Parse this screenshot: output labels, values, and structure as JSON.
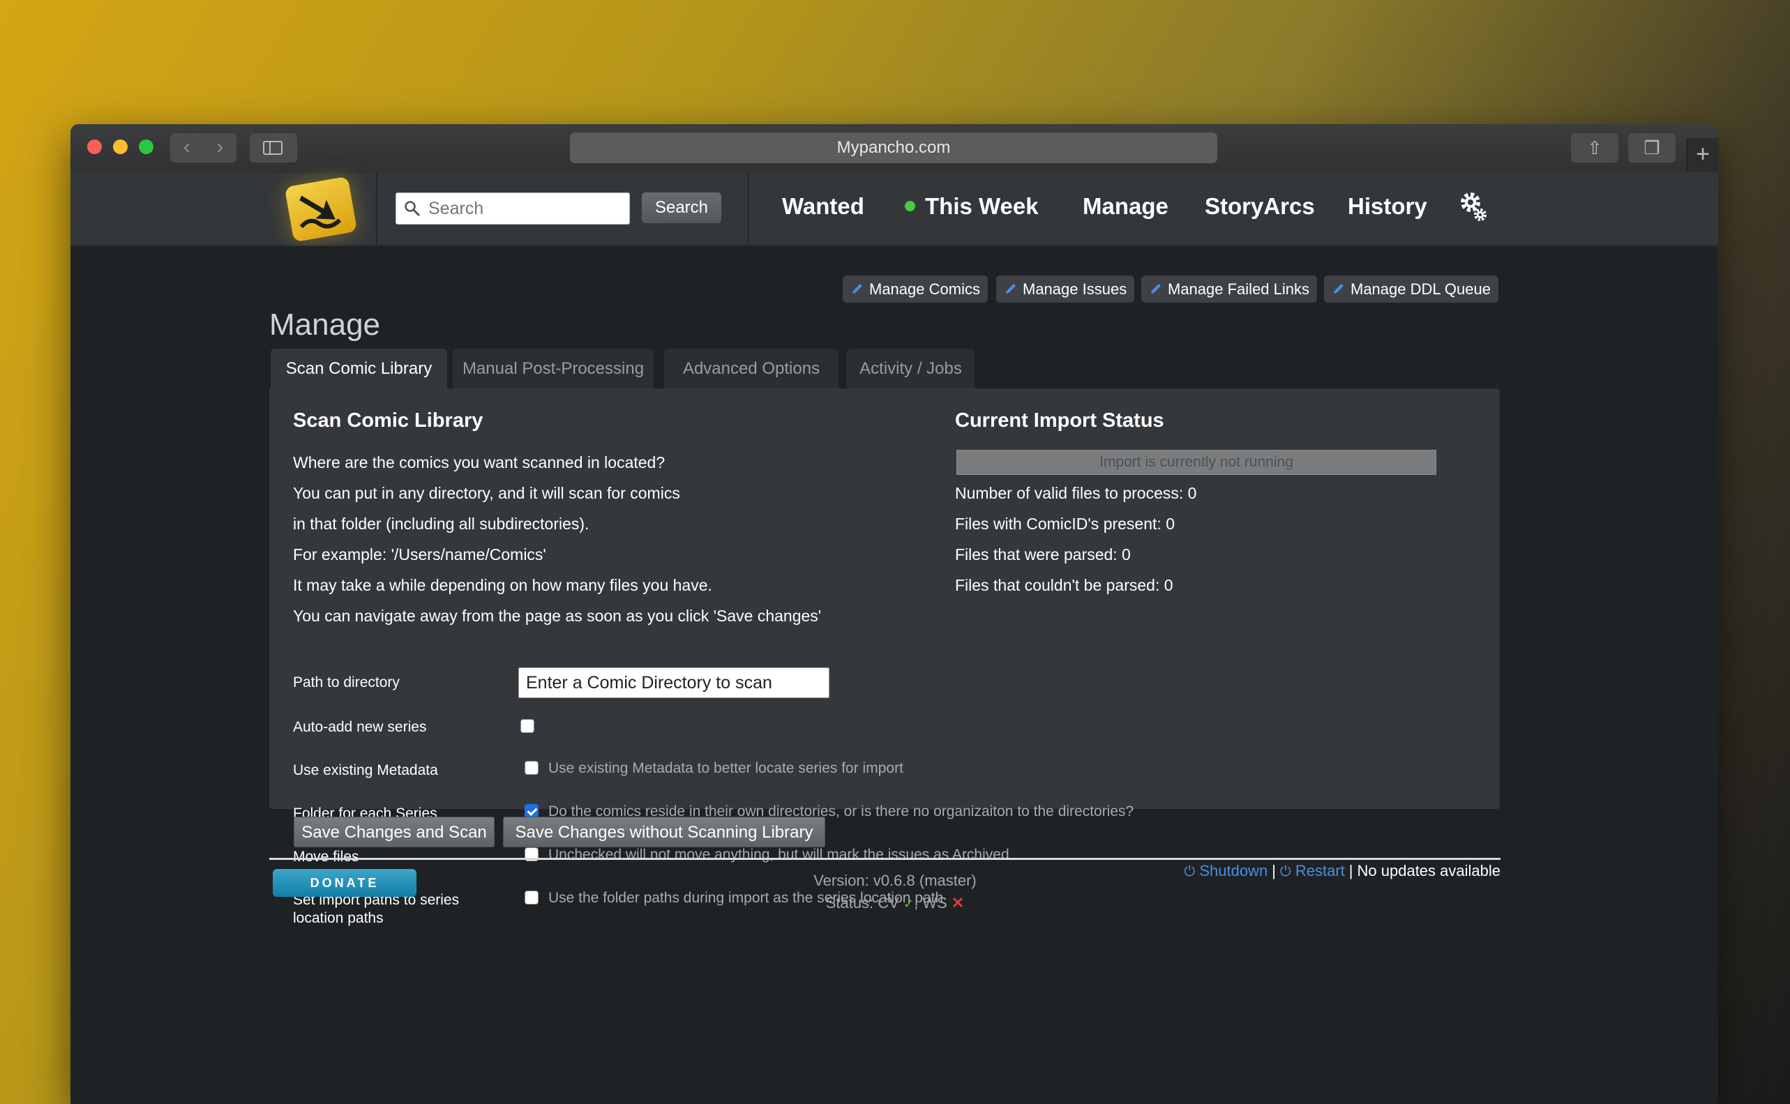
{
  "browser": {
    "url": "Mypancho.com"
  },
  "header": {
    "search_placeholder": "Search",
    "search_button": "Search",
    "nav": [
      "Wanted",
      "This Week",
      "Manage",
      "StoryArcs",
      "History"
    ]
  },
  "subnav": [
    "Manage Comics",
    "Manage Issues",
    "Manage Failed Links",
    "Manage DDL Queue"
  ],
  "page_title": "Manage",
  "tabs": [
    "Scan Comic Library",
    "Manual Post-Processing",
    "Advanced Options",
    "Activity / Jobs"
  ],
  "scan": {
    "heading": "Scan Comic Library",
    "lines": [
      "Where are the comics you want scanned in located?",
      "You can put in any directory, and it will scan for comics",
      "in that folder (including all subdirectories).",
      "For example: '/Users/name/Comics'",
      "It may take a while depending on how many files you have.",
      "You can navigate away from the page as soon as you click 'Save changes'"
    ]
  },
  "import_status": {
    "heading": "Current Import Status",
    "bar_text": "Import is currently not running",
    "lines": [
      "Number of valid files to process: 0",
      "Files with ComicID's present: 0",
      "Files that were parsed: 0",
      "Files that couldn't be parsed: 0"
    ]
  },
  "form": {
    "path_label": "Path to directory",
    "path_value": "Enter a Comic Directory to scan",
    "options": [
      {
        "label": "Auto-add new series",
        "desc": "",
        "checked": false
      },
      {
        "label": "Use existing Metadata",
        "desc": "Use existing Metadata to better locate series for import",
        "checked": false
      },
      {
        "label": "Folder for each Series",
        "desc": "Do the comics reside in their own directories, or is there no organizaiton to the directories?",
        "checked": true
      },
      {
        "label": "Move files",
        "desc": "Unchecked will not move anything, but will mark the issues as Archived",
        "checked": false
      },
      {
        "label": "Set import paths to series location paths",
        "desc": "Use the folder paths during import as the series location path",
        "checked": false
      }
    ],
    "save_scan": "Save Changes and Scan",
    "save_no_scan": "Save Changes without Scanning Library"
  },
  "footer": {
    "donate": "DONATE",
    "version": "Version: v0.6.8 (master)",
    "status_prefix": "Status: CV",
    "status_ws": ", WS",
    "shutdown": "Shutdown",
    "restart": "Restart",
    "updates": "No updates available"
  },
  "colors": {
    "accent_blue": "#4b8fe0",
    "checkbox_blue": "#1f6fe5",
    "status_ok": "#5fc04c",
    "status_bad": "#e03b3b"
  }
}
